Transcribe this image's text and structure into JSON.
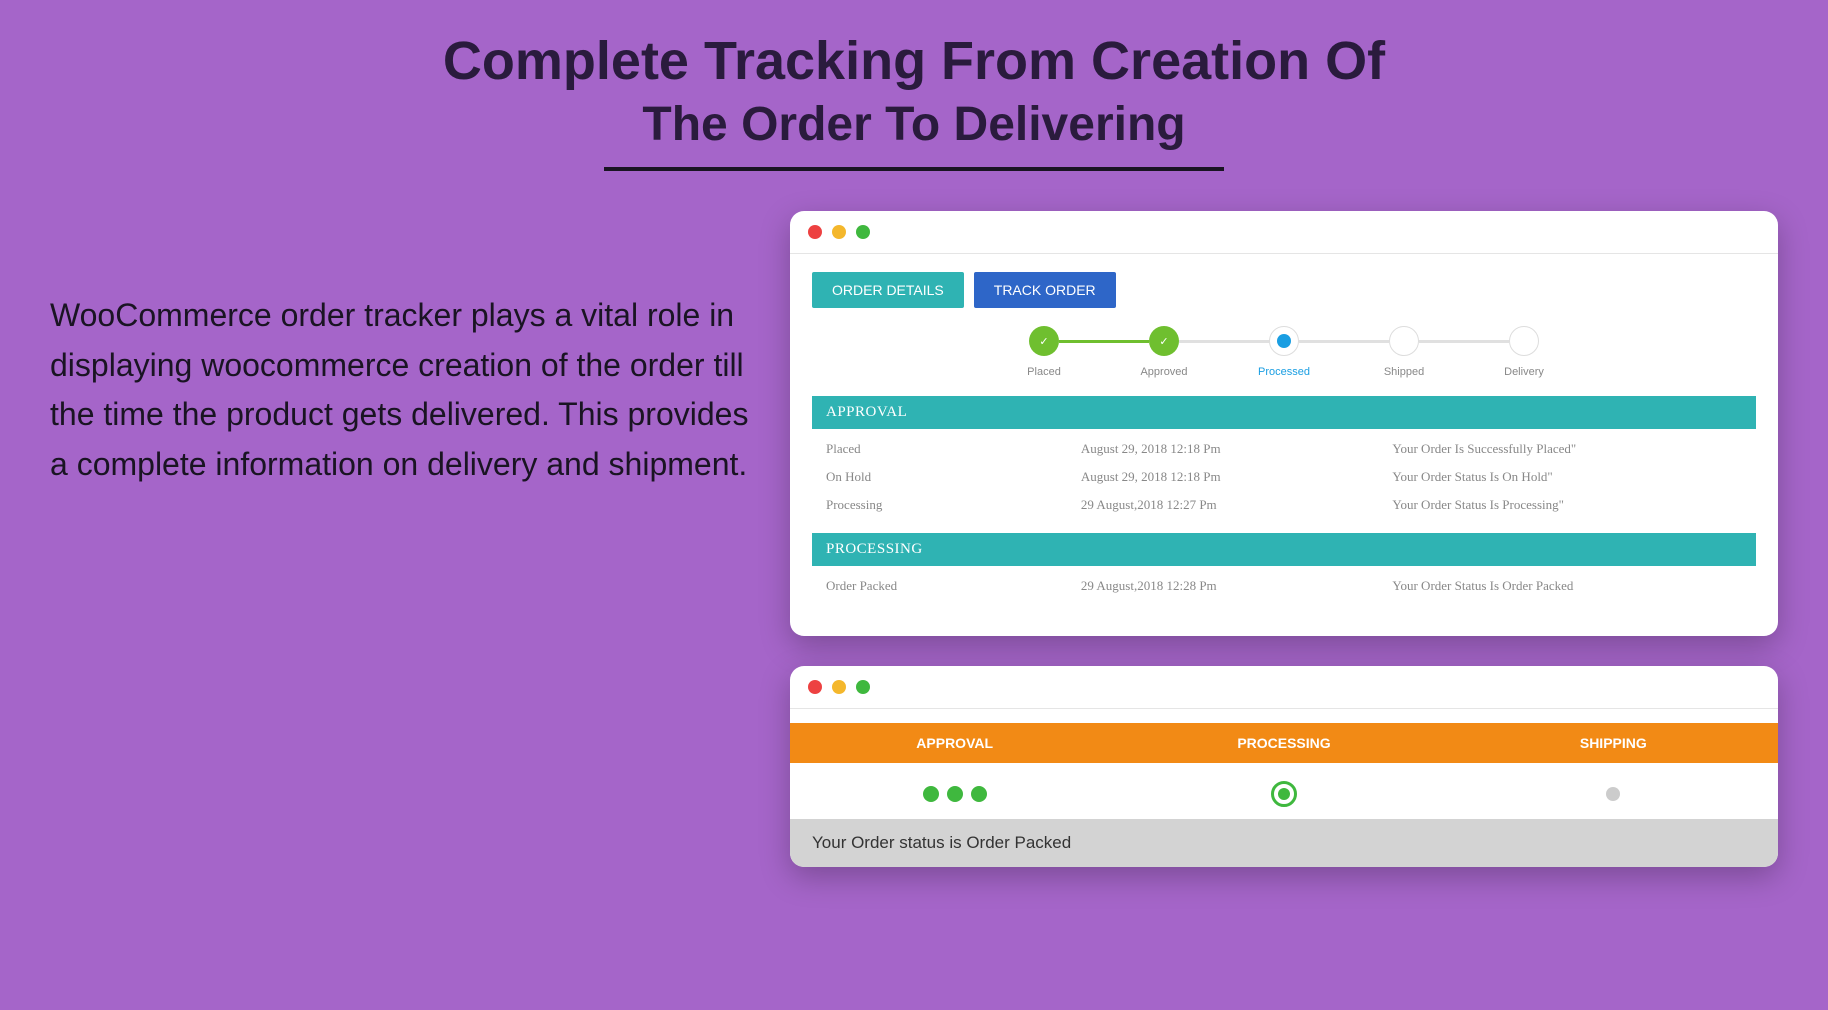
{
  "heading": {
    "line1": "Complete Tracking From Creation Of",
    "line2": "The Order To Delivering"
  },
  "body_text": "WooCommerce order tracker plays a vital role in displaying woocommerce creation of the order till the time the product gets delivered. This provides a complete information on delivery and shipment.",
  "window1": {
    "tabs": {
      "details": "ORDER DETAILS",
      "track": "TRACK ORDER"
    },
    "steps": {
      "placed": "Placed",
      "approved": "Approved",
      "processed": "Processed",
      "shipped": "Shipped",
      "delivery": "Delivery"
    },
    "sections": {
      "approval": {
        "title": "APPROVAL",
        "rows": [
          {
            "status": "Placed",
            "date": "August 29, 2018 12:18 Pm",
            "msg": "Your Order Is Successfully Placed\""
          },
          {
            "status": "On Hold",
            "date": "August 29, 2018 12:18 Pm",
            "msg": "Your Order Status Is On Hold\""
          },
          {
            "status": "Processing",
            "date": "29 August,2018 12:27 Pm",
            "msg": "Your Order Status Is Processing\""
          }
        ]
      },
      "processing": {
        "title": "PROCESSING",
        "rows": [
          {
            "status": "Order Packed",
            "date": "29 August,2018 12:28 Pm",
            "msg": "Your Order Status Is Order Packed"
          }
        ]
      }
    }
  },
  "window2": {
    "stages": {
      "approval": "APPROVAL",
      "processing": "PROCESSING",
      "shipping": "SHIPPING"
    },
    "status_message": "Your Order status is Order Packed"
  }
}
